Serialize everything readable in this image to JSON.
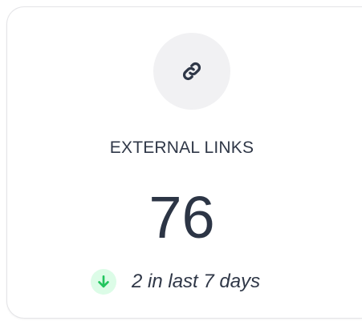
{
  "stat_card": {
    "icon": "link-icon",
    "label": "EXTERNAL LINKS",
    "value": "76",
    "trend": {
      "icon": "arrow-down-icon",
      "text": "2 in last 7 days",
      "color": "#22c55e"
    }
  },
  "colors": {
    "text": "#2f3747",
    "icon_bg": "#f1f1f3",
    "trend_bg": "#dcfce7",
    "trend_arrow": "#22c55e"
  }
}
